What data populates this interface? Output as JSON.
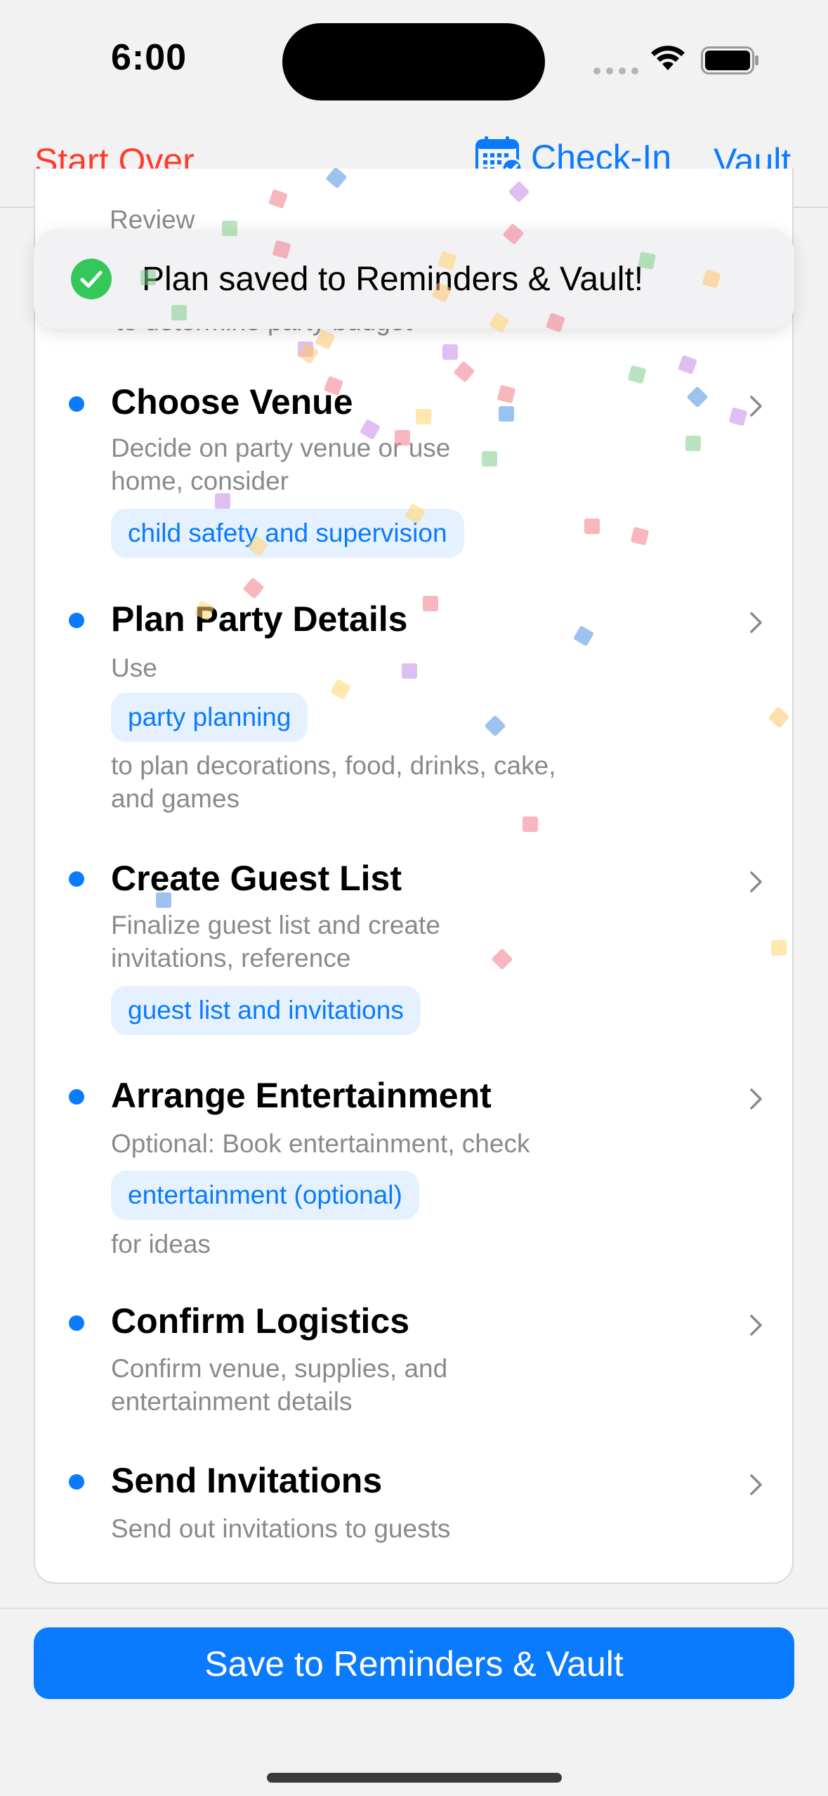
{
  "status_bar": {
    "time": "6:00"
  },
  "nav": {
    "left_label": "Start Over",
    "checkin_label": "Check-In",
    "vault_label": "Vault"
  },
  "peek": {
    "top_text": "Review",
    "under_text": "to determine party budget"
  },
  "toast": {
    "message": "Plan saved to Reminders & Vault!"
  },
  "steps": [
    {
      "title": "Choose Venue",
      "desc_lines": [
        "Decide on party venue or use",
        "home, consider"
      ],
      "chip": "child safety and supervision"
    },
    {
      "title": "Plan Party Details",
      "desc_lines": [
        "Use"
      ],
      "chip": "party planning",
      "after_lines": [
        " to plan decorations, food, drinks, cake,",
        "and games"
      ]
    },
    {
      "title": "Create Guest List",
      "desc_lines": [
        "Finalize guest list and create",
        "invitations, reference"
      ],
      "chip": "guest list and invitations"
    },
    {
      "title": "Arrange Entertainment",
      "desc_lines": [
        "Optional: Book entertainment, check"
      ],
      "chip": "entertainment (optional)",
      "after_lines": [
        " for ideas"
      ]
    },
    {
      "title": "Confirm Logistics",
      "desc_lines": [
        "Confirm venue, supplies, and",
        "entertainment details"
      ]
    },
    {
      "title": "Send Invitations",
      "desc_lines": [
        "Send out invitations to guests"
      ]
    }
  ],
  "save_button_label": "Save to Reminders & Vault",
  "colors": {
    "accent": "#0a7aff",
    "destructive": "#ff3b30",
    "chip_bg": "#e5f1ff",
    "success": "#34c759"
  }
}
